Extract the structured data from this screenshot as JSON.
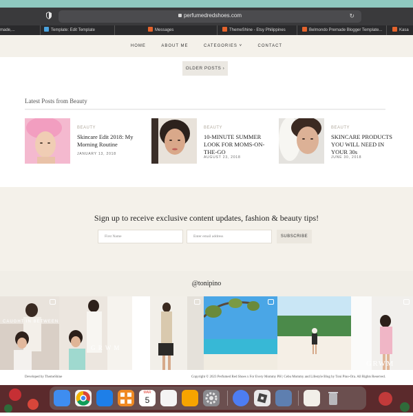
{
  "browser": {
    "url": "perfumedredshoes.com",
    "tabs": [
      {
        "label": "made,..."
      },
      {
        "label": "Template: Edit Template"
      },
      {
        "label": "Messages"
      },
      {
        "label": "ThemeShine - Etsy Philippines"
      },
      {
        "label": "Belmondo Premade Blogger Template..."
      },
      {
        "label": "Kasa"
      }
    ]
  },
  "nav": {
    "items": [
      "HOME",
      "ABOUT ME",
      "CATEGORIES ˅",
      "CONTACT"
    ]
  },
  "older_posts_label": "OLDER POSTS ›",
  "latest": {
    "title": "Latest Posts from Beauty",
    "posts": [
      {
        "category": "BEAUTY",
        "title": "Skincare Edit 2018: My Morning Routine",
        "date": "JANUARY 13, 2018"
      },
      {
        "category": "BEAUTY",
        "title": "10-MINUTE SUMMER LOOK FOR MOMS-ON-THE-GO",
        "date": "AUGUST 23, 2018"
      },
      {
        "category": "BEAUTY",
        "title": "SKINCARE PRODUCTS YOU WILL NEED IN YOUR 30s",
        "date": "JUNE 30, 2018"
      }
    ]
  },
  "newsletter": {
    "heading": "Sign up to receive exclusive content updates, fashion & beauty tips!",
    "first_name_placeholder": "First Name",
    "email_placeholder": "Enter email address",
    "subscribe_label": "SUBSCRIBE"
  },
  "instagram": {
    "handle": "@tonipino",
    "captions": [
      "CAUGHT IN BETWEEN",
      "G R W M",
      "GRWM"
    ]
  },
  "footer": {
    "left": "Developed by ThemeShine",
    "right": "Copyright © 2023 Perfumed Red Shoes x For Every Mommy PH | Cebu Mommy and Lifestyle Blog by Toni Pino-Ora. All Rights Reserved."
  },
  "dock": {
    "calendar_month": "MAR",
    "calendar_day": "5"
  },
  "colors": {
    "accent_beige": "#f4f1ea",
    "category_text": "#b0a89c",
    "teal_strip": "#8fc9c0"
  }
}
